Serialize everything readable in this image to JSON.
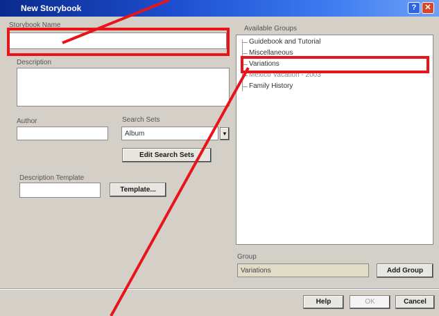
{
  "window": {
    "title": "New Storybook"
  },
  "fields": {
    "storybook_name": {
      "label": "Storybook Name",
      "value": ""
    },
    "description": {
      "label": "Description",
      "value": ""
    },
    "author": {
      "label": "Author",
      "value": ""
    },
    "search_sets": {
      "label": "Search Sets",
      "value": "Album"
    },
    "description_template": {
      "label": "Description Template",
      "value": ""
    },
    "group": {
      "label": "Group",
      "value": "Variations"
    }
  },
  "buttons": {
    "edit_search_sets": "Edit Search Sets",
    "template": "Template...",
    "add_group": "Add Group",
    "help": "Help",
    "ok": "OK",
    "cancel": "Cancel"
  },
  "available_groups": {
    "label": "Available Groups",
    "items": [
      "Guidebook and Tutorial",
      "Miscellaneous",
      "Variations",
      "Mexico Vacation - 2003",
      "Family History"
    ],
    "highlighted": "Variations"
  },
  "colors": {
    "annotation": "#e8141a",
    "titlebar": "#1d4fd0"
  }
}
